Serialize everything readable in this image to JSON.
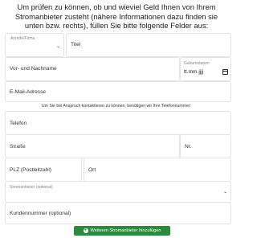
{
  "intro_text": "Um prüfen zu können, ob und wieviel Geld Ihnen von Ihrem Stromanbieter zusteht (nähere Informationen dazu finden sie unten bzw. rechts), füllen Sie bitte folgende Felder aus:",
  "form": {
    "salutation_label": "Anrede/Firma",
    "title_placeholder": "Titel",
    "name_placeholder": "Vor- und Nachname",
    "birthdate_label": "Geburtsdatum",
    "birthdate_value": "tt.mm.jjjj",
    "email_placeholder": "E-Mail-Adresse",
    "phone_hint": "Um Sie bei Anspruch kontaktieren zu können, benötigen wir Ihre Telefonnummer:",
    "phone_placeholder": "Telefon",
    "street_placeholder": "Straße",
    "house_number_placeholder": "Nr.",
    "zip_placeholder": "PLZ (Postleitzahl)",
    "city_placeholder": "Ort",
    "provider_label": "Stromanbieter (optional)",
    "customer_number_placeholder": "Kundennummer (optional)",
    "add_provider_button": "Weiteren Stromanbieter hinzufügen"
  },
  "icons": {
    "dropdown": "chevron-down-icon",
    "calendar": "calendar-icon",
    "add": "plus-circle-icon"
  },
  "colors": {
    "button": "#2b8a3e",
    "field_border": "#e3e3e3"
  }
}
